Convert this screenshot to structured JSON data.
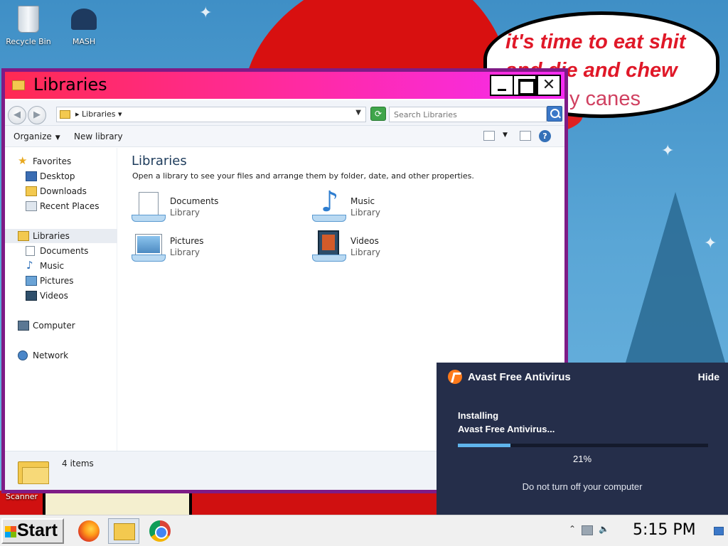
{
  "desktop": {
    "icons": [
      {
        "label": "Recycle Bin"
      },
      {
        "label": "MASH"
      }
    ],
    "partial_icon_label": "Scanner",
    "wallpaper_text": {
      "line1": "it's time to eat shit",
      "line2": "and die and chew",
      "line3": "y canes"
    }
  },
  "window": {
    "title": "Libraries",
    "address": {
      "crumb": "Libraries"
    },
    "search": {
      "placeholder": "Search Libraries"
    },
    "toolbar": {
      "organize": "Organize",
      "new_library": "New library"
    },
    "nav": {
      "favorites": "Favorites",
      "desktop": "Desktop",
      "downloads": "Downloads",
      "recent_places": "Recent Places",
      "libraries": "Libraries",
      "documents": "Documents",
      "music": "Music",
      "pictures": "Pictures",
      "videos": "Videos",
      "computer": "Computer",
      "network": "Network"
    },
    "content": {
      "heading": "Libraries",
      "subtitle": "Open a library to see your files and arrange them by folder, date, and other properties.",
      "libraries": [
        {
          "name": "Documents",
          "type": "Library"
        },
        {
          "name": "Music",
          "type": "Library"
        },
        {
          "name": "Pictures",
          "type": "Library"
        },
        {
          "name": "Videos",
          "type": "Library"
        }
      ]
    },
    "details": {
      "count": "4 items"
    }
  },
  "avast": {
    "title": "Avast Free Antivirus",
    "hide": "Hide",
    "status_line1": "Installing",
    "status_line2": "Avast Free Antivirus...",
    "progress": 0.21,
    "progress_text": "21%",
    "note": "Do not turn off your computer",
    "accent": "#5fb4ec",
    "background": "#252e4a"
  },
  "taskbar": {
    "start_label": "Start",
    "apps": [
      "firefox-icon",
      "file-explorer-icon",
      "chrome-icon"
    ],
    "clock": "5:15 PM"
  }
}
